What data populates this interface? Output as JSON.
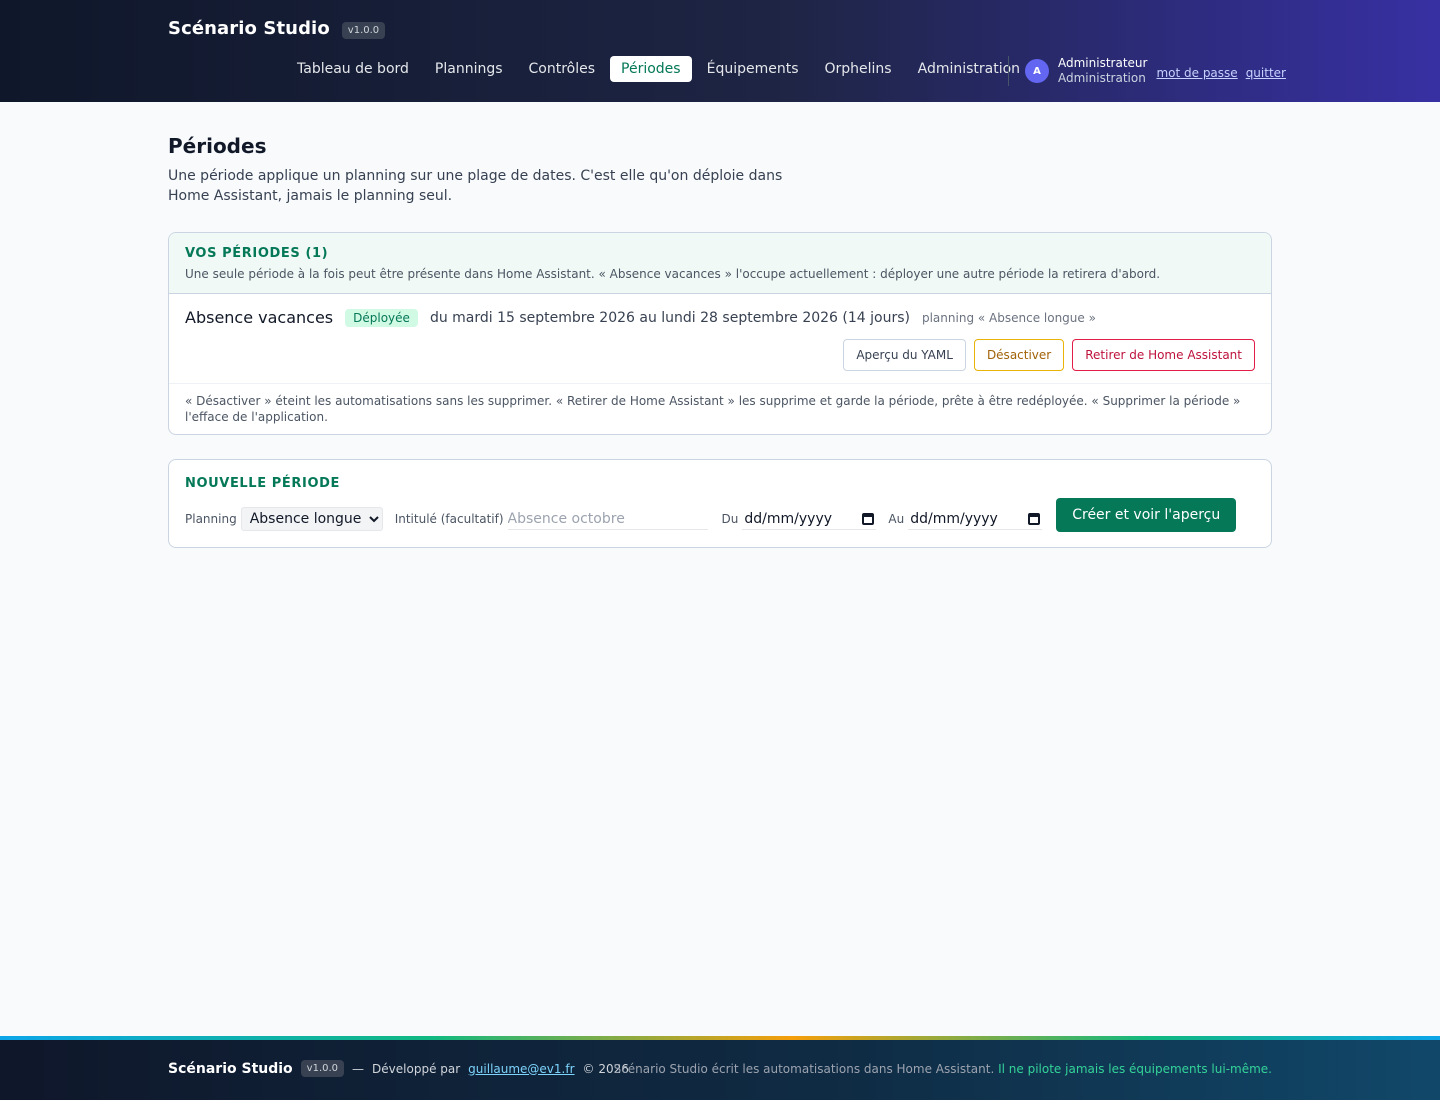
{
  "app": {
    "name": "Scénario Studio",
    "version": "v1.0.0"
  },
  "nav": {
    "items": [
      {
        "label": "Tableau de bord"
      },
      {
        "label": "Plannings"
      },
      {
        "label": "Contrôles"
      },
      {
        "label": "Périodes",
        "active": true
      },
      {
        "label": "Équipements"
      },
      {
        "label": "Orphelins"
      },
      {
        "label": "Administration"
      }
    ]
  },
  "user": {
    "initial": "A",
    "name": "Administrateur",
    "role": "Administration",
    "password_link": "mot de passe",
    "logout_link": "quitter"
  },
  "page": {
    "title": "Périodes",
    "description": "Une période applique un planning sur une plage de dates. C'est elle qu'on déploie dans Home Assistant, jamais le planning seul."
  },
  "periods_card": {
    "title": "Vos périodes (1)",
    "subtitle": "Une seule période à la fois peut être présente dans Home Assistant. « Absence vacances » l'occupe actuellement : déployer une autre période la retirera d'abord.",
    "items": [
      {
        "name": "Absence vacances",
        "status": "Déployée",
        "dates": "du mardi 15 septembre 2026 au lundi 28 septembre 2026 (14 jours)",
        "planning": "planning « Absence longue »",
        "actions": {
          "yaml": "Aperçu du YAML",
          "deactivate": "Désactiver",
          "remove": "Retirer de Home Assistant"
        }
      }
    ],
    "footnote": "« Désactiver » éteint les automatisations sans les supprimer. « Retirer de Home Assistant » les supprime et garde la période, prête à être redéployée. « Supprimer la période » l'efface de l'application."
  },
  "new_period": {
    "title": "Nouvelle période",
    "planning_label": "Planning",
    "planning_value": "Absence longue",
    "title_label": "Intitulé (facultatif)",
    "title_placeholder": "Absence octobre",
    "from_label": "Du",
    "from_value": "dd/mm/yyyy",
    "to_label": "Au",
    "to_value": "dd/mm/yyyy",
    "submit": "Créer et voir l'aperçu"
  },
  "footer": {
    "brand": "Scénario Studio",
    "version": "v1.0.0",
    "dash": "—",
    "dev_prefix": "Développé par",
    "dev_email": "guillaume@ev1.fr",
    "copyright": "© 2026",
    "note": "Scénario Studio écrit les automatisations dans Home Assistant.",
    "note_highlight": "Il ne pilote jamais les équipements lui-même."
  },
  "colors": {
    "accent": "#047857",
    "danger": "#be123c",
    "warning": "#a16207",
    "header_start": "#0f172a",
    "header_end": "#3730a3"
  }
}
